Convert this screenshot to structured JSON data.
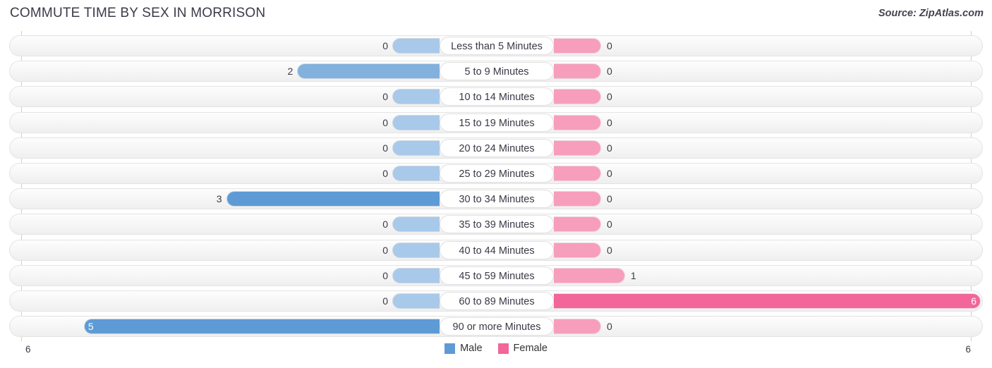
{
  "header": {
    "title": "COMMUTE TIME BY SEX IN MORRISON",
    "source": "Source: ZipAtlas.com"
  },
  "legend": {
    "items": [
      {
        "label": "Male",
        "color": "#5e9bd6"
      },
      {
        "label": "Female",
        "color": "#f2669a"
      }
    ]
  },
  "axis": {
    "left_tick": "6",
    "right_tick": "6"
  },
  "chart_data": {
    "type": "bar",
    "title": "COMMUTE TIME BY SEX IN MORRISON",
    "subtitle": "Source: ZipAtlas.com",
    "orientation": "horizontal",
    "layout": "diverging-bidirectional",
    "xlabel": "",
    "ylabel": "",
    "xlim": [
      6,
      6
    ],
    "grid": false,
    "legend_position": "bottom-center",
    "categories": [
      "Less than 5 Minutes",
      "5 to 9 Minutes",
      "10 to 14 Minutes",
      "15 to 19 Minutes",
      "20 to 24 Minutes",
      "25 to 29 Minutes",
      "30 to 34 Minutes",
      "35 to 39 Minutes",
      "40 to 44 Minutes",
      "45 to 59 Minutes",
      "60 to 89 Minutes",
      "90 or more Minutes"
    ],
    "series": [
      {
        "name": "Male",
        "color": "#5e9bd6",
        "direction": "left",
        "values": [
          0,
          2,
          0,
          0,
          0,
          0,
          3,
          0,
          0,
          0,
          0,
          5
        ],
        "labels": [
          "0",
          "2",
          "0",
          "0",
          "0",
          "0",
          "3",
          "0",
          "0",
          "0",
          "0",
          "5"
        ]
      },
      {
        "name": "Female",
        "color": "#f2669a",
        "direction": "right",
        "values": [
          0,
          0,
          0,
          0,
          0,
          0,
          0,
          0,
          0,
          1,
          6,
          0
        ],
        "labels": [
          "0",
          "0",
          "0",
          "0",
          "0",
          "0",
          "0",
          "0",
          "0",
          "1",
          "6",
          "0"
        ]
      }
    ],
    "max_value": 6
  }
}
